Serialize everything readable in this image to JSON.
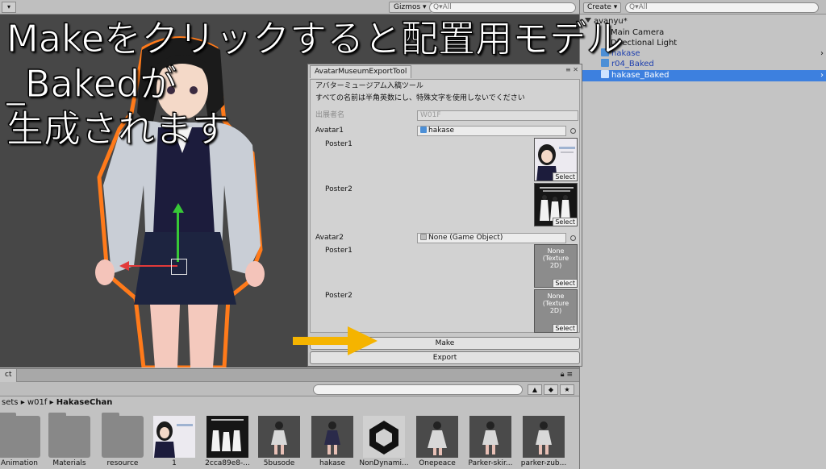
{
  "caption": {
    "line1": "Makeをクリックすると配置用モデル",
    "line2": "_Bakedが",
    "line3": "生成されます"
  },
  "scene": {
    "gizmos_label": "Gizmos",
    "search_placeholder": "Q▾All"
  },
  "tool": {
    "tab_title": "AvatarMuseumExportTool",
    "heading": "アバターミュージアム入稿ツール",
    "notice": "すべての名前は半角英数にし、特殊文字を使用しないでください",
    "exhibitor_label": "出展者名",
    "exhibitor_value": "W01F",
    "avatar1_label": "Avatar1",
    "avatar1_value": "hakase",
    "avatar1_poster1_label": "Poster1",
    "avatar1_poster2_label": "Poster2",
    "avatar2_label": "Avatar2",
    "avatar2_value": "None (Game Object)",
    "avatar2_poster1_label": "Poster1",
    "avatar2_poster2_label": "Poster2",
    "none_texture": "None\n(Texture\n2D)",
    "select_label": "Select",
    "make_label": "Make",
    "export_label": "Export",
    "arrow_color": "#f5b400"
  },
  "hierarchy": {
    "create_label": "Create ▾",
    "search_placeholder": "Q▾All",
    "items": [
      {
        "label": "avanyu*"
      },
      {
        "label": "Main Camera"
      },
      {
        "label": "Directional Light"
      },
      {
        "label": "hakase"
      },
      {
        "label": "r04_Baked"
      },
      {
        "label": "hakase_Baked"
      }
    ]
  },
  "project": {
    "tab_label": "ct",
    "search_placeholder": "",
    "breadcrumb": {
      "a": "sets",
      "sep": "▸",
      "b": "w01f",
      "c": "HakaseChan"
    },
    "assets": [
      {
        "label": "Animation"
      },
      {
        "label": "Materials"
      },
      {
        "label": "resource"
      },
      {
        "label": "1"
      },
      {
        "label": "2cca89e8-..."
      },
      {
        "label": "5busode"
      },
      {
        "label": "hakase"
      },
      {
        "label": "NonDynami..."
      },
      {
        "label": "Onepeace"
      },
      {
        "label": "Parker-skir..."
      },
      {
        "label": "parker-zub..."
      }
    ]
  }
}
